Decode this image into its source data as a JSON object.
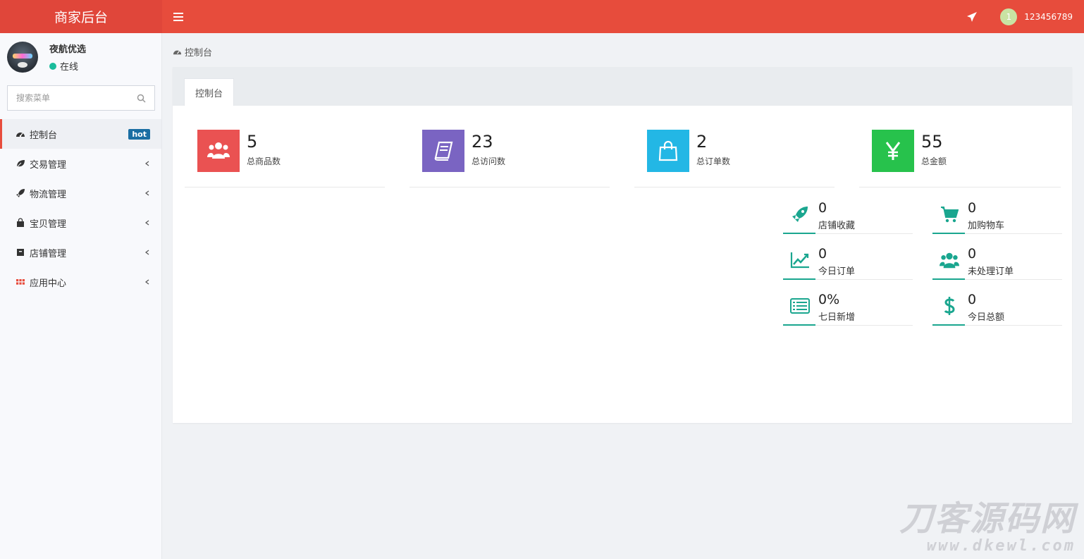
{
  "topbar": {
    "brand": "商家后台",
    "avatar_text": "1",
    "username": "123456789"
  },
  "sidebar": {
    "user": {
      "name": "夜航优选",
      "status": "在线"
    },
    "search": {
      "placeholder": "搜索菜单"
    },
    "items": [
      {
        "label": "控制台",
        "icon": "dashboard-icon",
        "badge": "hot",
        "active": true
      },
      {
        "label": "交易管理",
        "icon": "leaf-icon"
      },
      {
        "label": "物流管理",
        "icon": "rocket-icon"
      },
      {
        "label": "宝贝管理",
        "icon": "shopping-bag-icon"
      },
      {
        "label": "店铺管理",
        "icon": "archive-icon"
      },
      {
        "label": "应用中心",
        "icon": "grid-icon"
      }
    ]
  },
  "breadcrumb": {
    "label": "控制台"
  },
  "panel": {
    "tab": "控制台",
    "stats": [
      {
        "value": "5",
        "label": "总商品数",
        "color": "#ea5252",
        "icon": "users-icon"
      },
      {
        "value": "23",
        "label": "总访问数",
        "color": "#7a64c2",
        "icon": "book-icon"
      },
      {
        "value": "2",
        "label": "总订单数",
        "color": "#23b7e5",
        "icon": "shopping-bag-icon"
      },
      {
        "value": "55",
        "label": "总金额",
        "color": "#27c24c",
        "icon": "yen-icon"
      }
    ],
    "mini_stats": [
      {
        "value": "0",
        "label": "店铺收藏",
        "icon": "rocket-icon"
      },
      {
        "value": "0",
        "label": "加购物车",
        "icon": "cart-icon"
      },
      {
        "value": "0",
        "label": "今日订单",
        "icon": "line-chart-icon"
      },
      {
        "value": "0",
        "label": "未处理订单",
        "icon": "users-icon"
      },
      {
        "value": "0%",
        "label": "七日新增",
        "icon": "list-icon"
      },
      {
        "value": "0",
        "label": "今日总额",
        "icon": "dollar-icon"
      }
    ]
  },
  "watermark": {
    "main": "刀客源码网",
    "sub": "www.dkewl.com"
  },
  "colors": {
    "primary": "#e74c3c",
    "accent": "#1aa68f",
    "badge": "#1a6ea3"
  }
}
